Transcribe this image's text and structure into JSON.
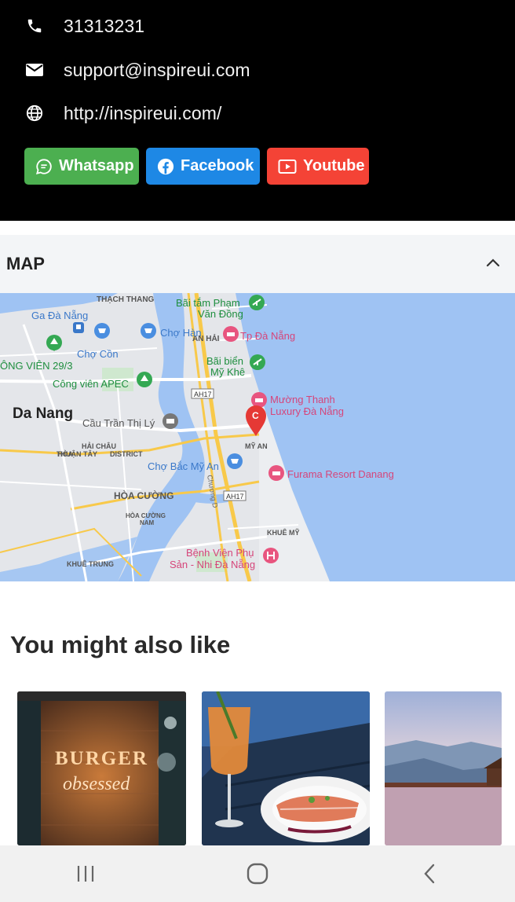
{
  "contact": {
    "phone": "31313231",
    "email": "support@inspireui.com",
    "website": "http://inspireui.com/"
  },
  "socials": {
    "whatsapp": "Whatsapp",
    "facebook": "Facebook",
    "youtube": "Youtube"
  },
  "map": {
    "title": "MAP",
    "labels": {
      "thach_thang": "THẠCH THANG",
      "bai_tam": "Bãi tắm Phạm",
      "van_dong": "Văn Đồng",
      "ga_da_nang": "Ga Đà Nẵng",
      "cho_han": "Chợ Hàn",
      "an_hai": "AN HẢI",
      "tp_da_nang": "Tp Đà Nẵng",
      "cho_con": "Chợ Cồn",
      "cong_vien_293": "ÔNG VIÊN 29/3",
      "bai_bien": "Bãi biển",
      "my_khe": "Mỹ Khê",
      "cong_vien_apec": "Công viên APEC",
      "ah17a": "AH17",
      "muong_thanh": "Mường Thanh",
      "luxury": "Luxury Đà Nẵng",
      "da_nang": "Da Nang",
      "cau_tran": "Cầu Trần Thị Lý",
      "hoa": "HÒA",
      "thuan_tay": "THUẬN TÂY",
      "hai_chau": "HẢI CHÂU",
      "district": "DISTRICT",
      "my_an": "MỸ AN",
      "cho_bac_my_an": "Chợ Bắc Mỹ An",
      "furama": "Furama Resort Danang",
      "hoa_cuong": "HÒA CƯỜNG",
      "ah17b": "AH17",
      "hoa_cuong_nam_1": "HÒA CƯỜNG",
      "hoa_cuong_nam_2": "NAM",
      "khue_my": "KHUÊ MỸ",
      "benh_vien_1": "Bệnh Viện Phụ",
      "benh_vien_2": "Sản - Nhi Đà Nẵng",
      "khue_trung": "KHUÊ TRUNG",
      "chuong_d": "Chương D",
      "marker_letter": "C"
    }
  },
  "suggestions": {
    "title": "You might also like",
    "cards": [
      "burger-restaurant",
      "cocktail-salmon-dish",
      "mountain-pier"
    ]
  },
  "colors": {
    "whatsapp": "#4caf50",
    "facebook": "#1e88e5",
    "youtube": "#f44336",
    "water": "#9fc3f3",
    "road": "#f8c94a"
  }
}
